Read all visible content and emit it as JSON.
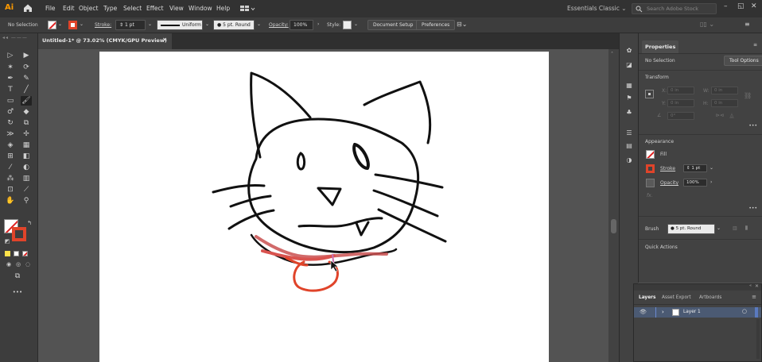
{
  "app": {
    "logo": "Ai",
    "workspace": "Essentials Classic",
    "search_placeholder": "Search Adobe Stock"
  },
  "menu": [
    "File",
    "Edit",
    "Object",
    "Type",
    "Select",
    "Effect",
    "View",
    "Window",
    "Help"
  ],
  "control_bar": {
    "selection": "No Selection",
    "stroke_label": "Stroke:",
    "stroke_weight": "1 pt",
    "profile": "Uniform",
    "brush": "5 pt. Round",
    "opacity_label": "Opacity:",
    "opacity": "100%",
    "style_label": "Style:",
    "doc_setup": "Document Setup",
    "preferences": "Preferences"
  },
  "document_tab": {
    "title": "Untitled-1* @ 73.02% (CMYK/GPU Preview)",
    "close": "×"
  },
  "properties": {
    "title": "Properties",
    "selection": "No Selection",
    "tool_options": "Tool Options",
    "transform": {
      "title": "Transform",
      "x_label": "X:",
      "x_value": "0 in",
      "y_label": "Y:",
      "y_value": "0 in",
      "w_label": "W:",
      "w_value": "0 in",
      "h_label": "H:",
      "h_value": "0 in",
      "angle_value": "0°"
    },
    "appearance": {
      "title": "Appearance",
      "fill": "Fill",
      "stroke": "Stroke",
      "stroke_weight": "1 pt",
      "opacity": "Opacity",
      "opacity_value": "100%",
      "fx": "fx."
    },
    "brush": {
      "label": "Brush",
      "value": "5 pt. Round"
    },
    "quick_actions": "Quick Actions",
    "more": "•••"
  },
  "layers": {
    "tabs": [
      "Layers",
      "Asset Export",
      "Artboards"
    ],
    "items": [
      {
        "name": "Layer 1"
      }
    ]
  },
  "colors": {
    "menubar": "#323232",
    "panel": "#424242",
    "pasteboard": "#535353",
    "artboard": "#ffffff",
    "stroke_red": "#e0442a",
    "accent_orange": "#ff9a00",
    "layer_highlight": "#4b5a73",
    "drawing": "#111111",
    "collar": "#d9534f"
  },
  "icons": {
    "home": "home-icon",
    "search": "search-icon",
    "minimize": "minimize-icon",
    "maximize": "maximize-icon",
    "close": "close-icon",
    "eye": "eye-icon"
  }
}
